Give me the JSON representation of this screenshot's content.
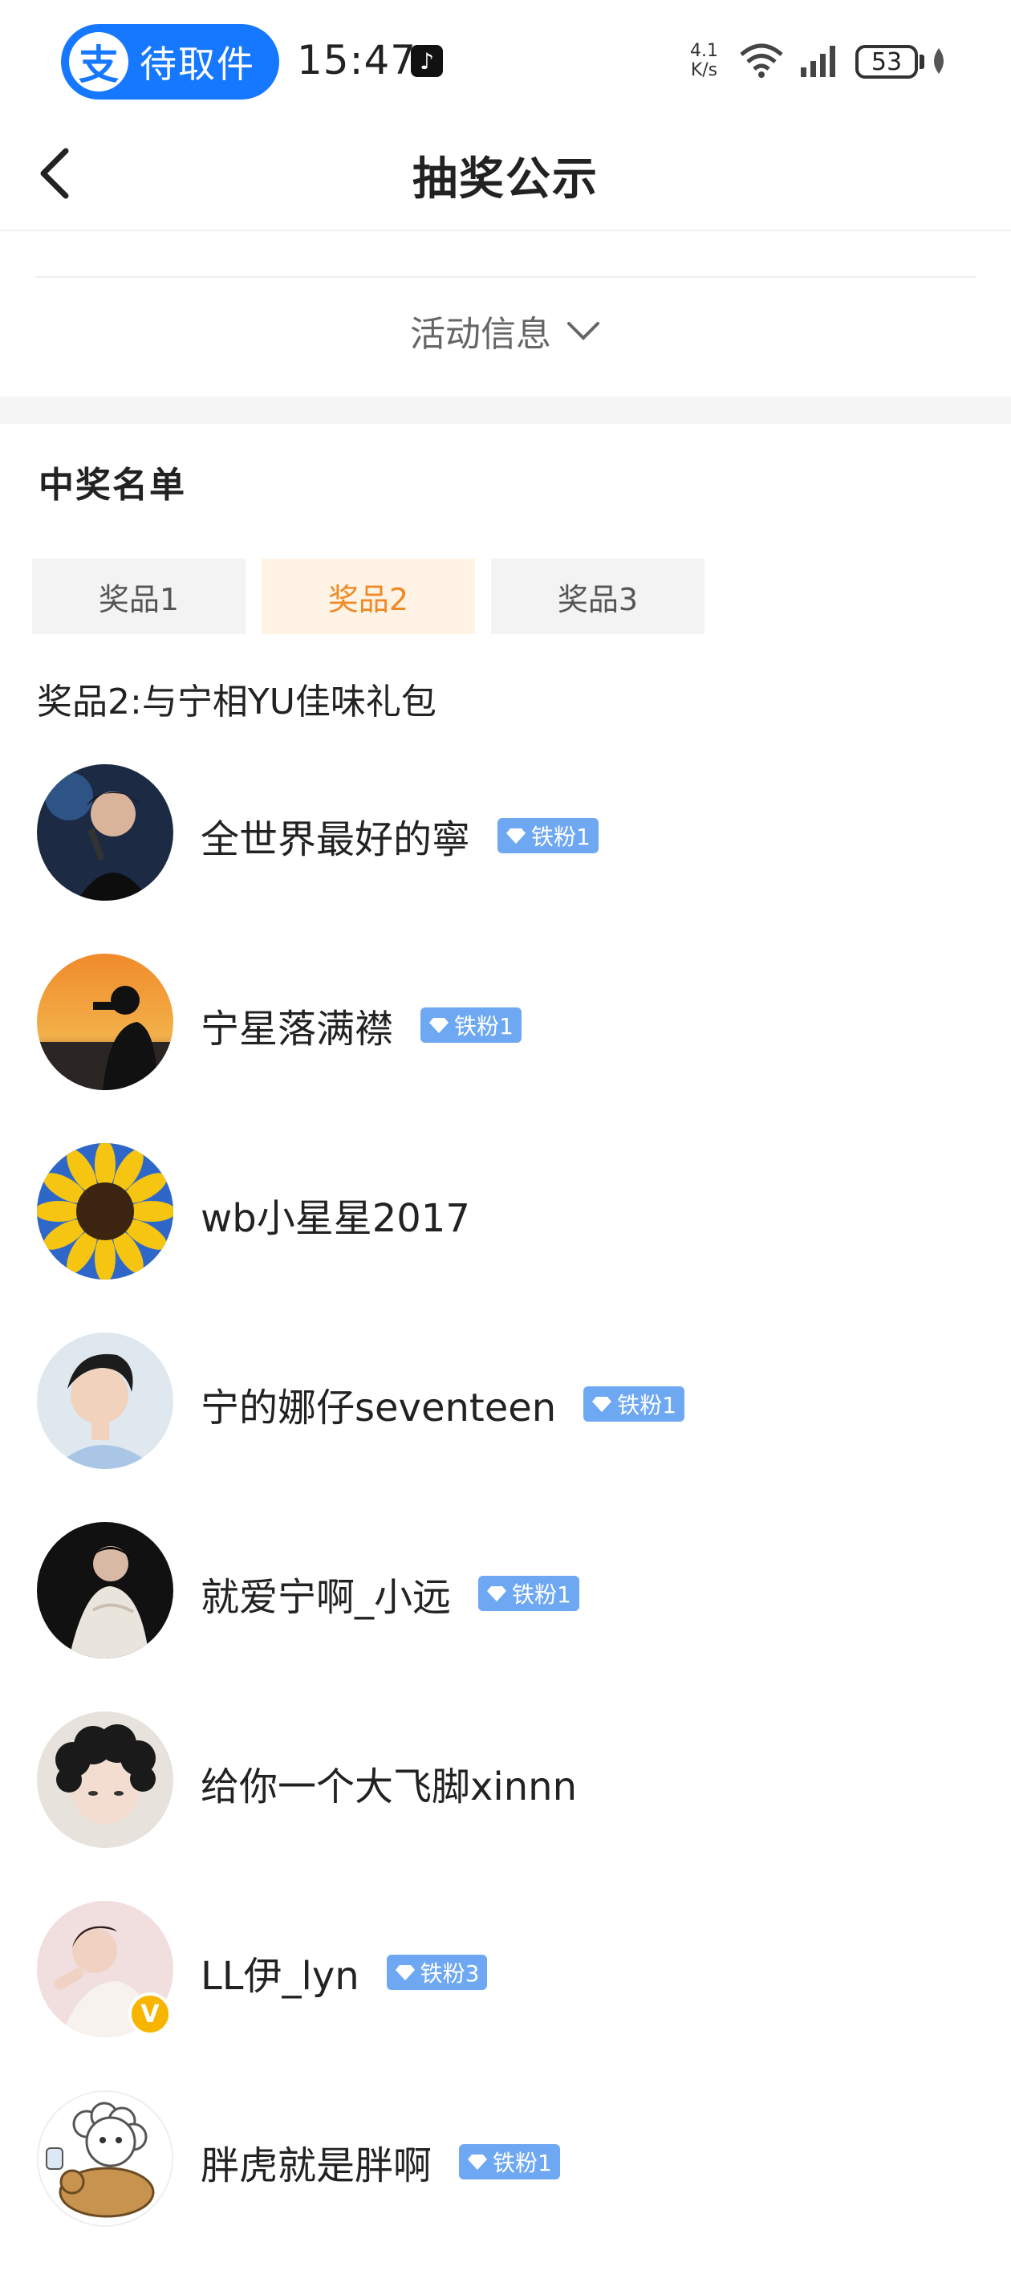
{
  "status_bar": {
    "pill_icon": "支",
    "pill_text": "待取件",
    "time": "15:47",
    "net_speed_value": "4.1",
    "net_speed_unit": "K/s",
    "battery": "53"
  },
  "nav": {
    "title": "抽奖公示"
  },
  "activity_info": {
    "label": "活动信息"
  },
  "winners": {
    "section_title": "中奖名单",
    "tabs": [
      {
        "label": "奖品1",
        "active": false
      },
      {
        "label": "奖品2",
        "active": true
      },
      {
        "label": "奖品3",
        "active": false
      }
    ],
    "prize_text": "奖品2:与宁相YU佳味礼包",
    "users": [
      {
        "name": "全世界最好的寧",
        "badge": "铁粉1",
        "avatar": "singer-photo"
      },
      {
        "name": "宁星落满襟",
        "badge": "铁粉1",
        "avatar": "sunset-silhouette"
      },
      {
        "name": "wb小星星2017",
        "badge": "",
        "avatar": "sunflower"
      },
      {
        "name": "宁的娜仔seventeen",
        "badge": "铁粉1",
        "avatar": "portrait-blue"
      },
      {
        "name": "就爱宁啊_小远",
        "badge": "铁粉1",
        "avatar": "portrait-dark"
      },
      {
        "name": "给你一个大飞脚xinnn",
        "badge": "",
        "avatar": "curly-hair"
      },
      {
        "name": "LL伊_lyn",
        "badge": "铁粉3",
        "avatar": "portrait-pink",
        "verified": "V"
      },
      {
        "name": "胖虎就是胖啊",
        "badge": "铁粉1",
        "avatar": "cartoon-sheep"
      }
    ]
  },
  "colors": {
    "accent_blue": "#1677ff",
    "tab_active_text": "#f08a24",
    "tab_active_bg": "#fff3e6",
    "fan_badge": "#6ea8f2"
  }
}
